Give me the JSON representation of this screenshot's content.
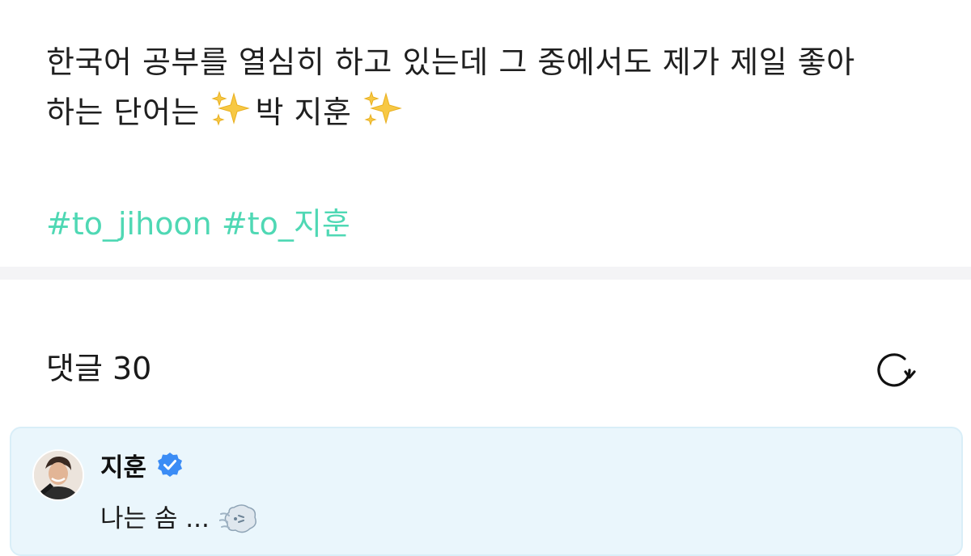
{
  "post": {
    "line1": "한국어 공부를 열심히 하고 있는데 그 중에서도 제가 제일 좋아",
    "line2_start": "하는 단어는 ",
    "line2_name": "박 지훈 ",
    "hashtags": [
      "#to_jihoon",
      "#to_지훈"
    ]
  },
  "comments": {
    "header": "댓글 30",
    "items": [
      {
        "author": "지훈",
        "text": "나는 솜 ..."
      }
    ]
  },
  "colors": {
    "hashtag": "#4fd8b4",
    "comment_bg": "#eaf6fc",
    "verified": "#3b8cf5"
  },
  "icons": [
    "sparkles-icon",
    "refresh-icon",
    "verified-badge-icon",
    "wind-face-icon"
  ]
}
